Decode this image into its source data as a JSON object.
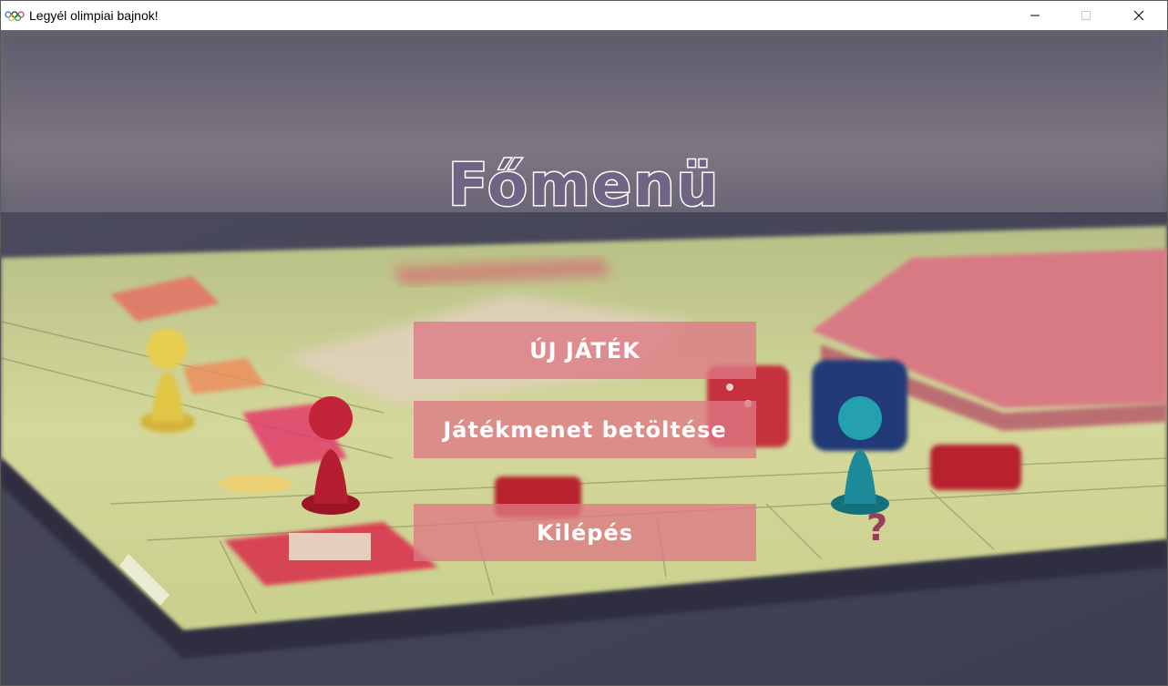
{
  "window": {
    "title": "Legyél olimpiai bajnok!",
    "icon": "olympic-rings-icon",
    "controls": {
      "minimize": "minimize-icon",
      "maximize": "maximize-icon",
      "close": "close-icon"
    }
  },
  "menu": {
    "heading": "Főmenü",
    "buttons": {
      "new_game": "ÚJ JÁTÉK",
      "load_game": "Játékmenet betöltése",
      "exit": "Kilépés"
    }
  },
  "colors": {
    "button_bg": "#de7884",
    "heading_fill": "#6e6585",
    "heading_outline": "#ffffff"
  }
}
